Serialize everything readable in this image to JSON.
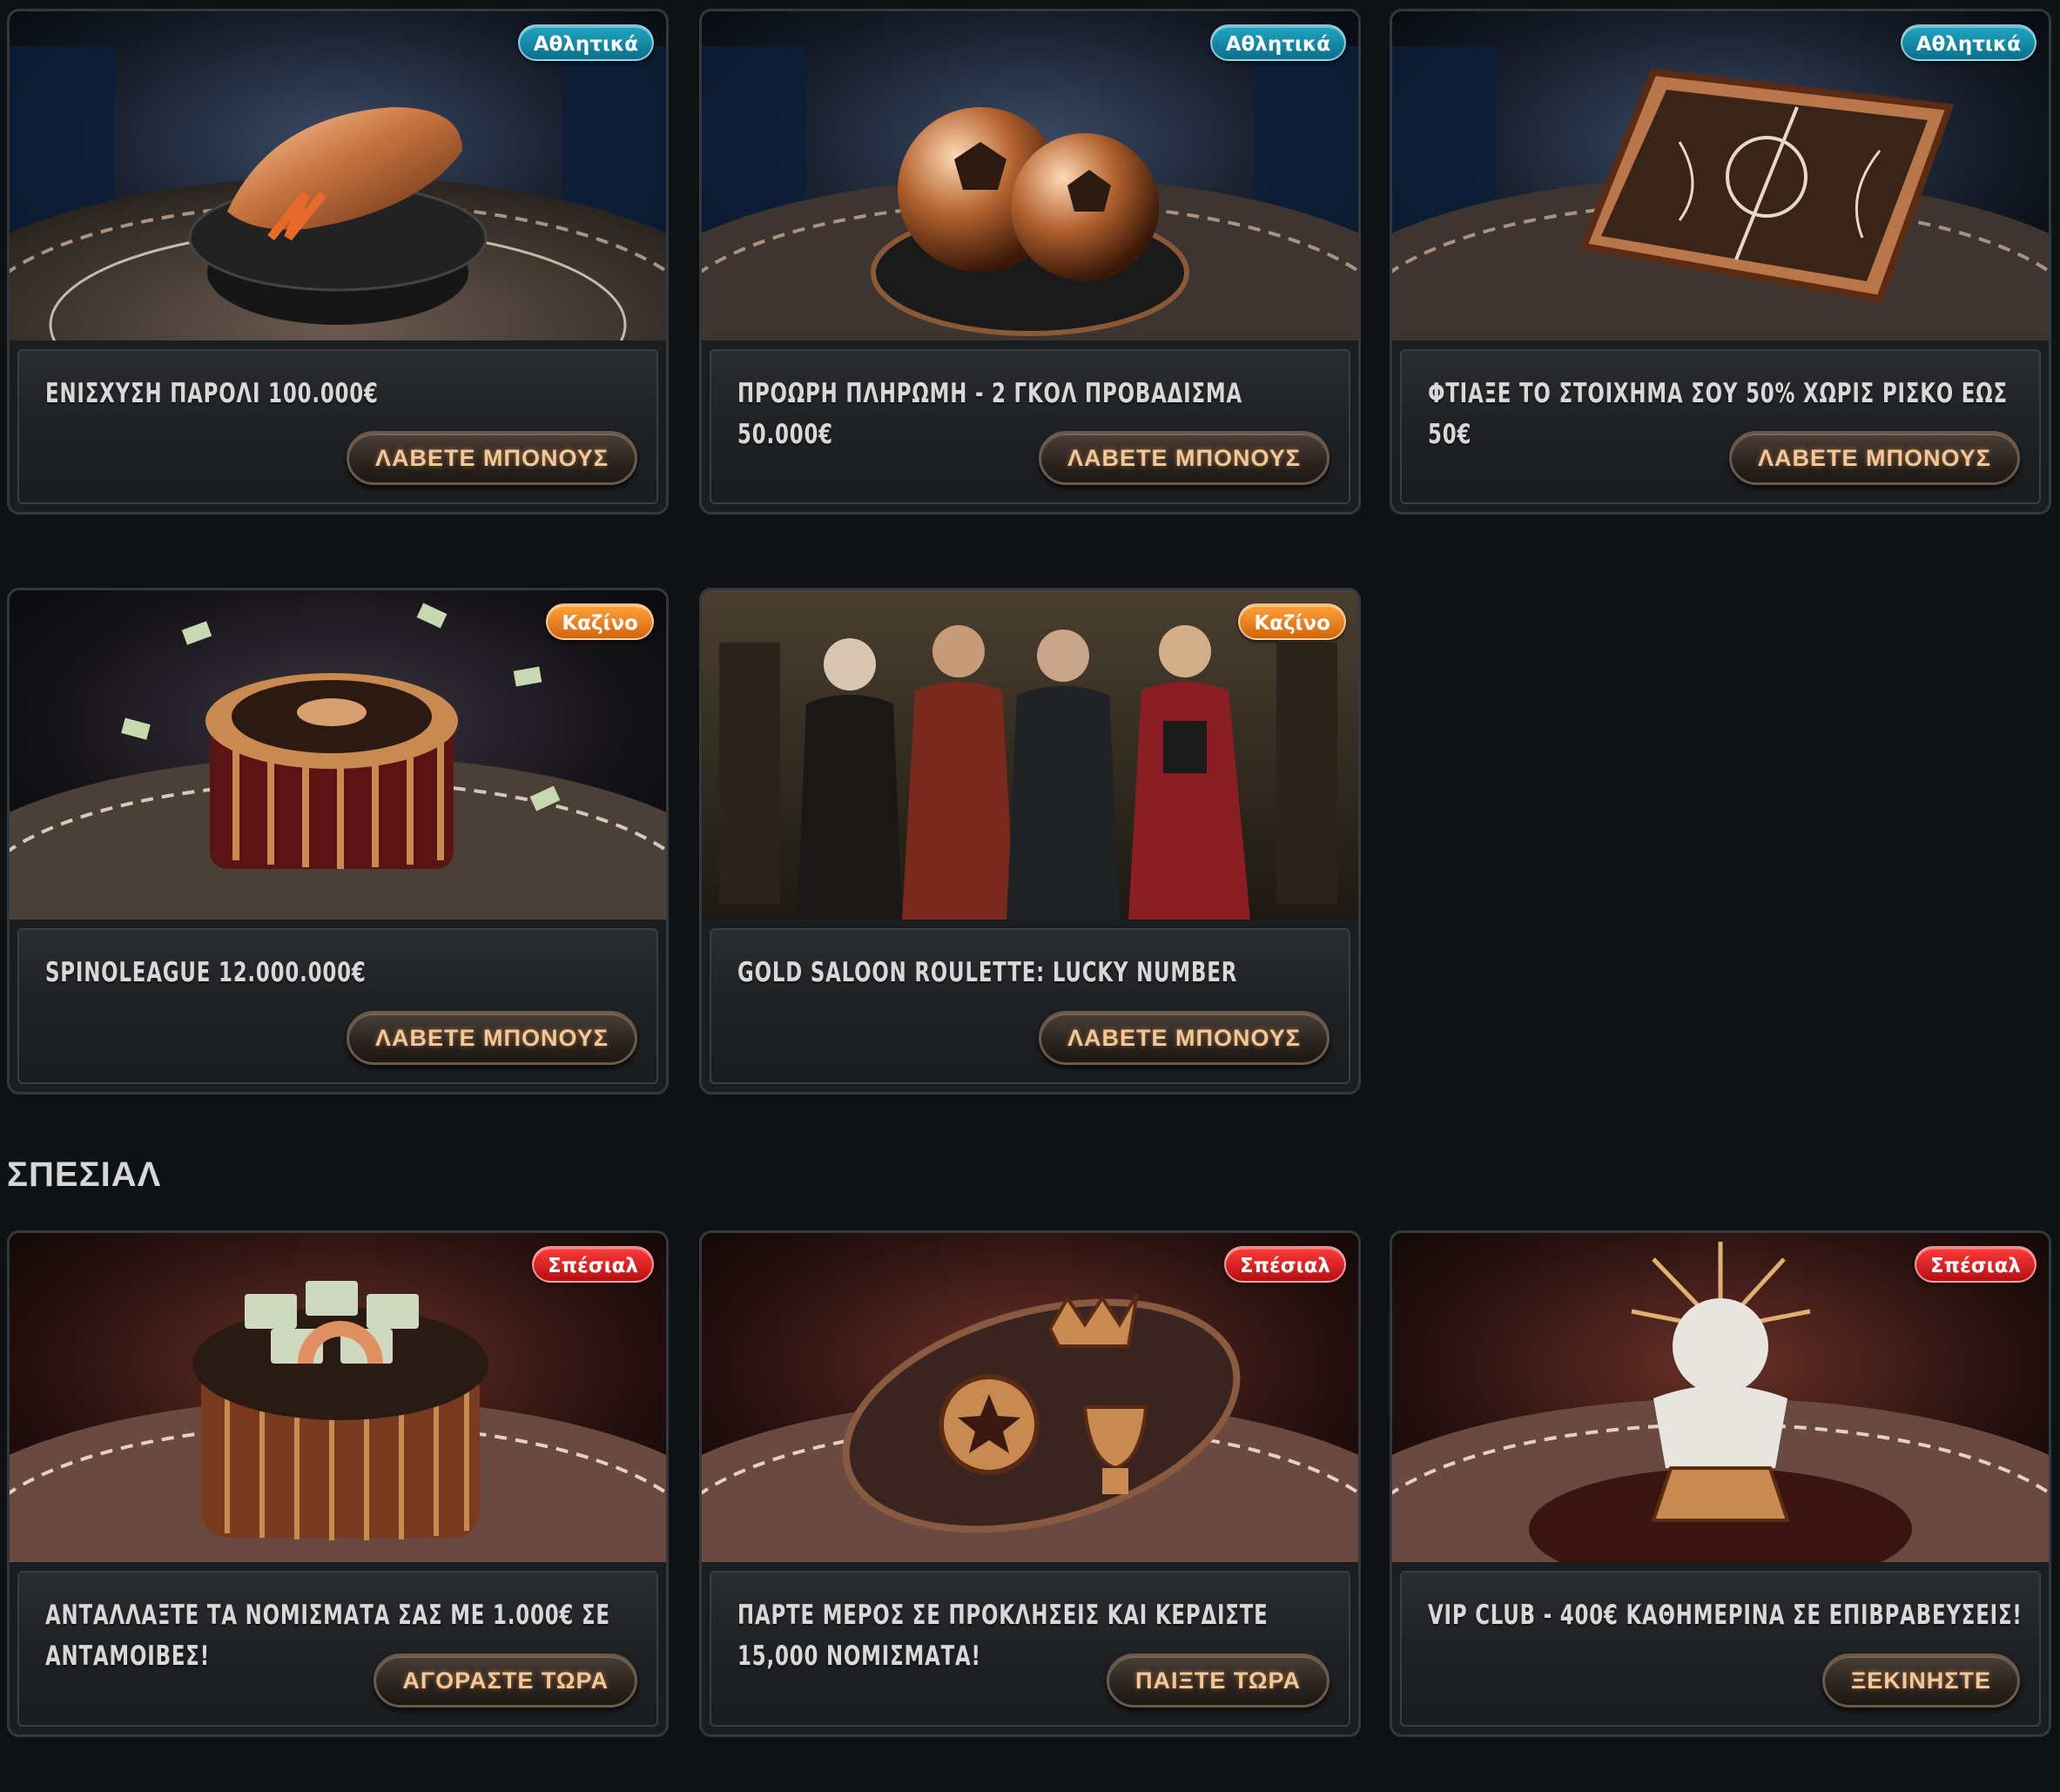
{
  "colors": {
    "page_bg": "#0f1215",
    "card_bg": "#1b1d21",
    "badge_sport": "#128bab",
    "badge_casino": "#f07d1a",
    "badge_special": "#e01d1f",
    "button_text": "#f2c89a"
  },
  "cards": [
    {
      "badge": "Αθλητικά",
      "title": "ΕΝΙΣΧΥΣΗ ΠΑΡΟΛΙ 100.000€",
      "button": "ΛΑΒΕΤΕ ΜΠΟΝΟΥΣ",
      "art_icon": "golden-boot-icon"
    },
    {
      "badge": "Αθλητικά",
      "title": "ΠΡΟΩΡΗ ΠΛΗΡΩΜΗ - 2 ΓΚΟΛ ΠΡΟΒΑΔΙΣΜΑ 50.000€",
      "button": "ΛΑΒΕΤΕ ΜΠΟΝΟΥΣ",
      "art_icon": "football-icon"
    },
    {
      "badge": "Αθλητικά",
      "title": "ΦΤΙΑΞΕ ΤΟ ΣΤΟΙΧΗΜΑ ΣΟΥ 50% ΧΩΡΙΣ ΡΙΣΚΟ ΕΩΣ 50€",
      "button": "ΛΑΒΕΤΕ ΜΠΟΝΟΥΣ",
      "art_icon": "tactics-board-icon"
    },
    {
      "badge": "Καζίνο",
      "title": "SPINOLEAGUE 12.000.000€",
      "button": "ΛΑΒΕΤΕ ΜΠΟΝΟΥΣ",
      "art_icon": "roulette-icon"
    },
    {
      "badge": "Καζίνο",
      "title": "GOLD SALOON ROULETTE: LUCKY NUMBER",
      "button": "ΛΑΒΕΤΕ ΜΠΟΝΟΥΣ",
      "art_icon": "characters-icon"
    }
  ],
  "special_section": {
    "title": "ΣΠΕΣΙΑΛ",
    "cards": [
      {
        "badge": "Σπέσιαλ",
        "title": "ΑΝΤΑΛΛΑΞΤΕ ΤΑ ΝΟΜΙΣΜΑΤΑ ΣΑΣ ΜΕ 1.000€ ΣΕ ΑΝΤΑΜΟΙΒΕΣ!",
        "button": "ΑΓΟΡΑΣΤΕ ΤΩΡΑ",
        "art_icon": "money-stack-icon"
      },
      {
        "badge": "Σπέσιαλ",
        "title": "ΠΑΡΤΕ ΜΕΡΟΣ ΣΕ ΠΡΟΚΛΗΣΕΙΣ ΚΑΙ ΚΕΡΔΙΣΤΕ 15,000 ΝΟΜΙΣΜΑΤΑ!",
        "button": "ΠΑΙΞΤΕ ΤΩΡΑ",
        "art_icon": "crown-trophy-icon"
      },
      {
        "badge": "Σπέσιαλ",
        "title": "VIP CLUB - 400€ ΚΑΘΗΜΕΡΙΝΑ ΣΕ ΕΠΙΒΡΑΒΕΥΣΕΙΣ!",
        "button": "ΞΕΚΙΝΗΣΤΕ",
        "art_icon": "statue-icon"
      }
    ]
  }
}
